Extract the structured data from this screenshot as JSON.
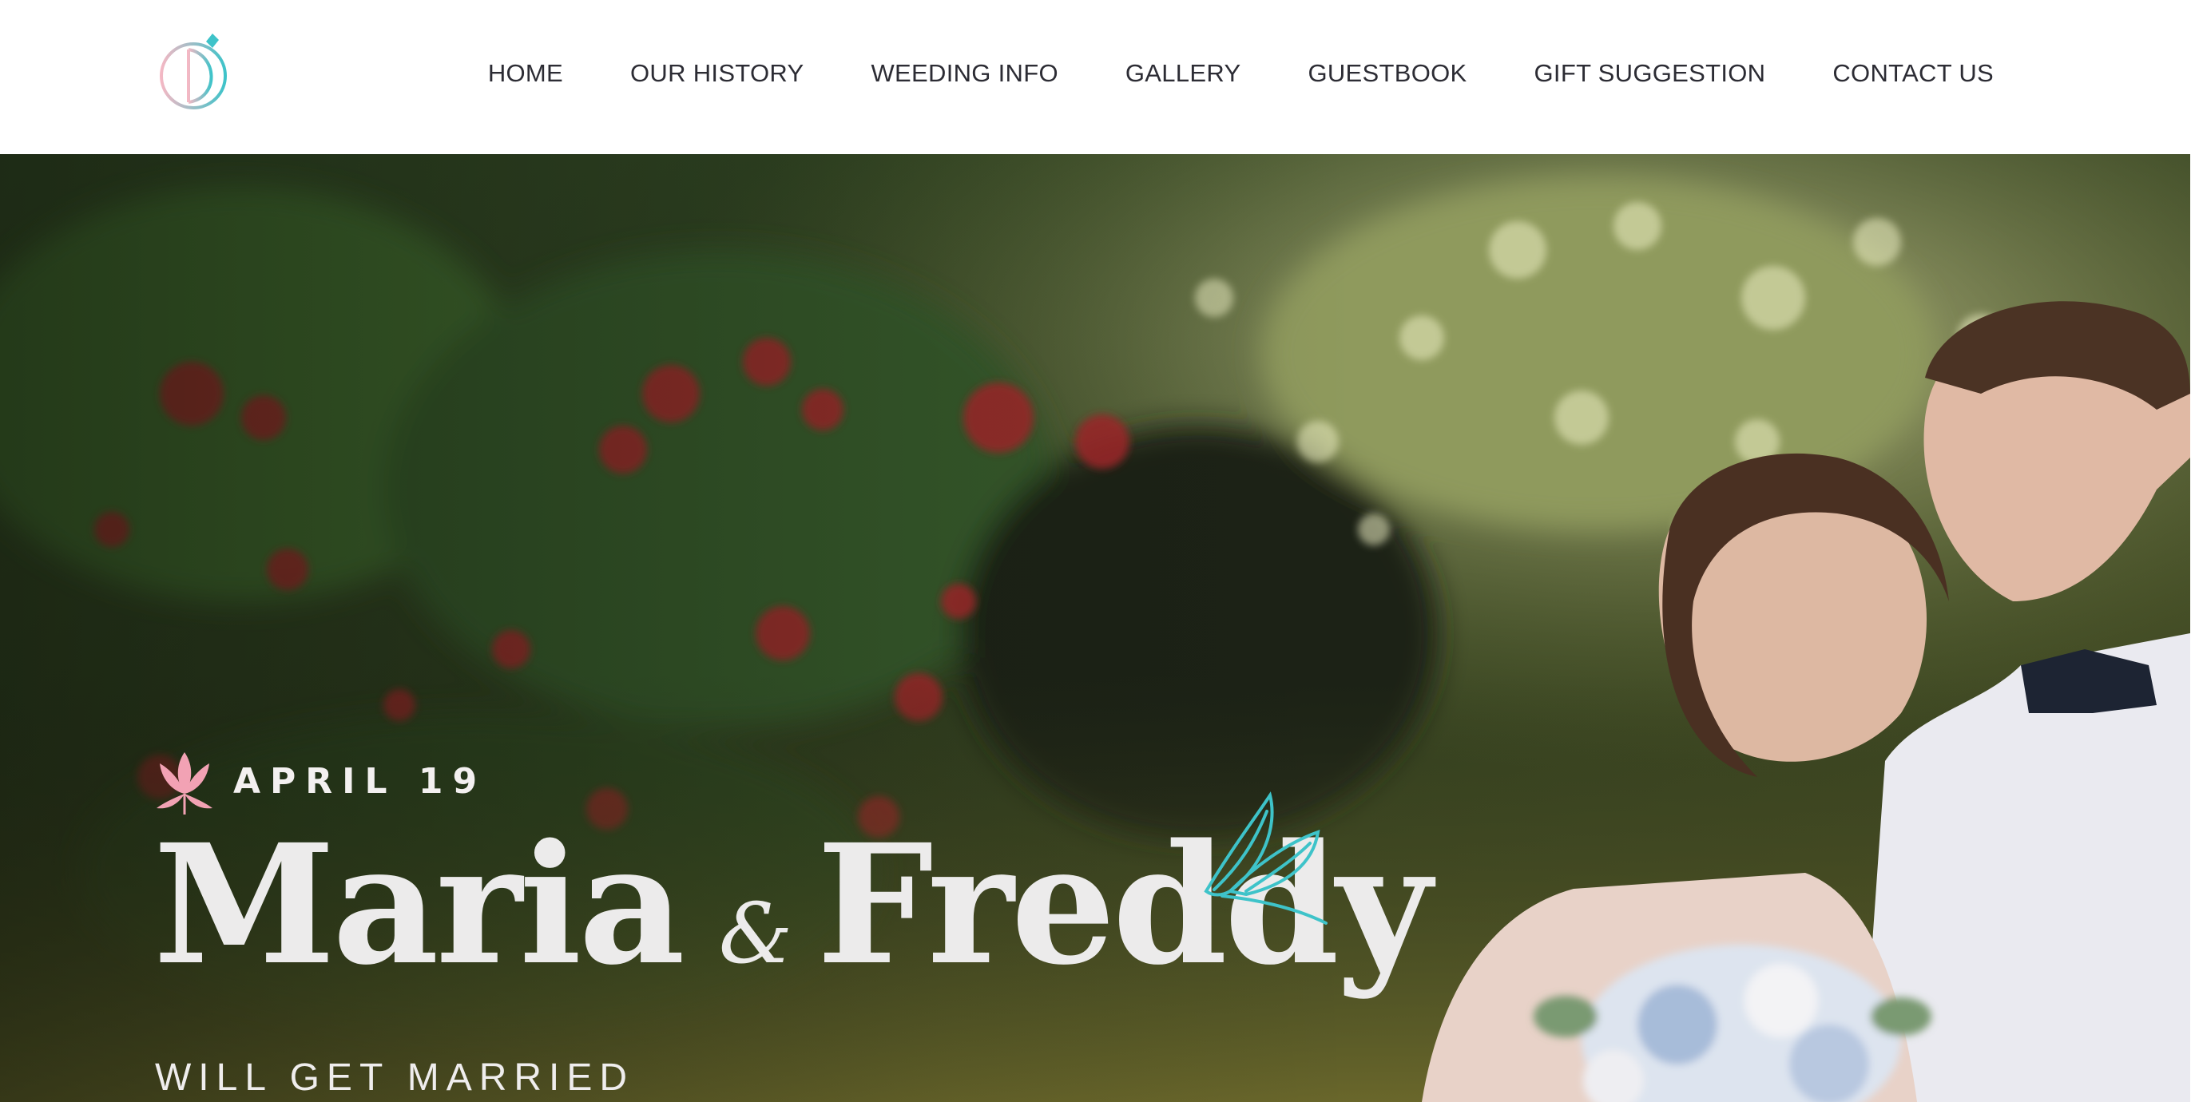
{
  "header": {
    "logo_icon": "ring-monogram-icon",
    "nav": [
      {
        "label": "HOME"
      },
      {
        "label": "OUR HISTORY"
      },
      {
        "label": "WEEDING INFO"
      },
      {
        "label": "GALLERY"
      },
      {
        "label": "GUESTBOOK"
      },
      {
        "label": "GIFT SUGGESTION"
      },
      {
        "label": "CONTACT US"
      }
    ]
  },
  "hero": {
    "background": "bride-and-groom-photo",
    "date_icon": "lotus-icon",
    "date": "APRIL 19",
    "name_one": "Maria",
    "ampersand": "&",
    "name_two": "Freddy",
    "ornament_icon": "leaf-icon",
    "subtitle": "WILL GET MARRIED"
  },
  "colors": {
    "accent_teal": "#3ec3c9",
    "accent_pink": "#f2a2b4",
    "nav_text": "#2c2c34",
    "hero_text": "#ecebeb"
  }
}
